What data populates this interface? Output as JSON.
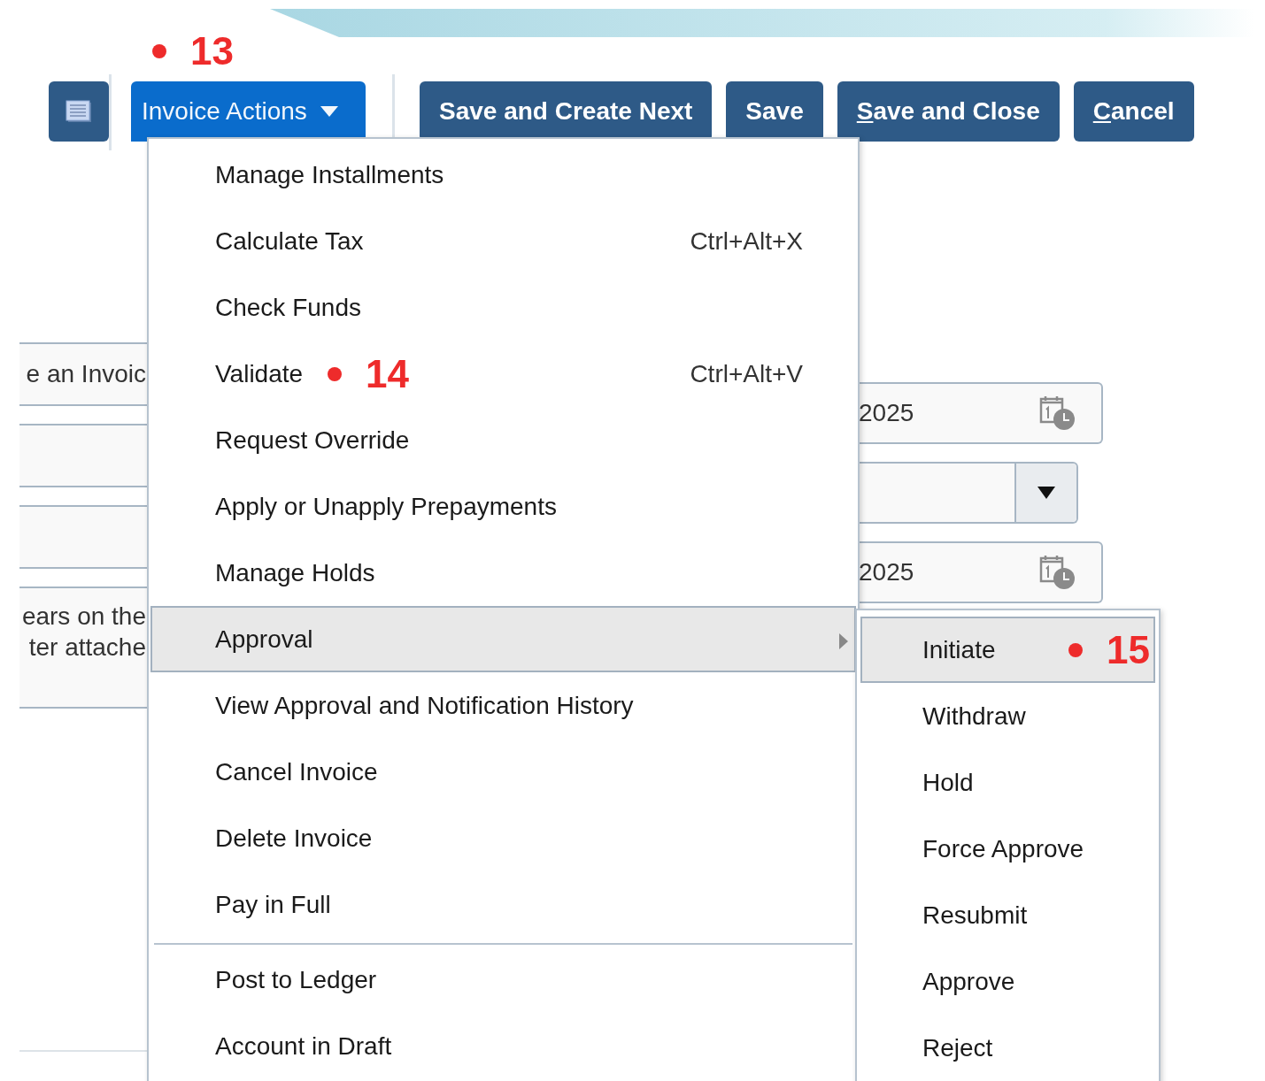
{
  "toolbar": {
    "menu_button": {
      "label": "Invoice Actions",
      "expanded": true,
      "callout": "13"
    },
    "buttons": [
      {
        "label": "Save and Create Next",
        "access_key": false
      },
      {
        "label": "Save",
        "access_key": false
      },
      {
        "label": "Save and Close",
        "access_key": true
      },
      {
        "label": "Cancel",
        "access_key": true
      }
    ]
  },
  "background_form": {
    "left_fields": [
      {
        "kind": "field",
        "lines": [
          "e an Invoic"
        ]
      },
      {
        "kind": "field"
      },
      {
        "kind": "field"
      },
      {
        "kind": "textarea",
        "lines": [
          "ears on the",
          "ter attache"
        ]
      }
    ],
    "right_fields": [
      {
        "kind": "date",
        "value": "2025"
      },
      {
        "kind": "select"
      },
      {
        "kind": "date",
        "value": "2025"
      }
    ]
  },
  "menu": {
    "groups": [
      [
        {
          "label": "Manage Installments",
          "selected": false,
          "has_submenu": false
        },
        {
          "label": "Calculate Tax",
          "shortcut": "Ctrl+Alt+X",
          "selected": false,
          "has_submenu": false
        },
        {
          "label": "Check Funds",
          "selected": false,
          "has_submenu": false
        },
        {
          "label": "Validate",
          "shortcut": "Ctrl+Alt+V",
          "callout": "14",
          "selected": false,
          "has_submenu": false
        },
        {
          "label": "Request Override",
          "selected": false,
          "has_submenu": false
        },
        {
          "label": "Apply or Unapply Prepayments",
          "selected": false,
          "has_submenu": false
        },
        {
          "label": "Manage Holds",
          "selected": false,
          "has_submenu": false
        },
        {
          "label": "Approval",
          "selected": true,
          "has_submenu": true
        },
        {
          "label": "View Approval and Notification History",
          "selected": false,
          "has_submenu": false
        },
        {
          "label": "Cancel Invoice",
          "selected": false,
          "has_submenu": false
        },
        {
          "label": "Delete Invoice",
          "selected": false,
          "has_submenu": false
        },
        {
          "label": "Pay in Full",
          "selected": false,
          "has_submenu": false
        }
      ],
      [
        {
          "label": "Post to Ledger",
          "selected": false,
          "has_submenu": false
        },
        {
          "label": "Account in Draft",
          "selected": false,
          "has_submenu": false
        }
      ]
    ]
  },
  "submenu": {
    "items": [
      {
        "label": "Initiate",
        "callout": "15",
        "selected": true
      },
      {
        "label": "Withdraw",
        "selected": false
      },
      {
        "label": "Hold",
        "selected": false
      },
      {
        "label": "Force Approve",
        "selected": false
      },
      {
        "label": "Resubmit",
        "selected": false
      },
      {
        "label": "Approve",
        "selected": false
      },
      {
        "label": "Reject",
        "selected": false
      }
    ]
  }
}
